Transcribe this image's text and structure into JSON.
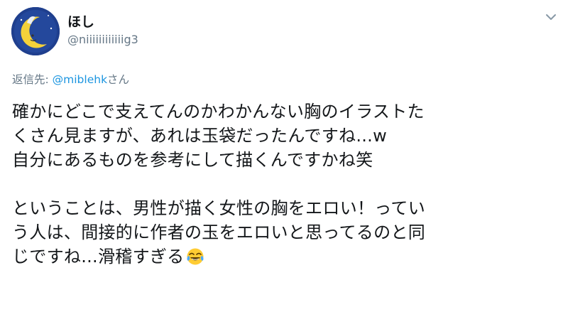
{
  "tweet": {
    "display_name": "ほし",
    "handle": "@niiiiiiiiiiiig3",
    "reply": {
      "prefix": "返信先: ",
      "mention": "@miblehk",
      "suffix": "さん"
    },
    "body_lines": [
      "確かにどこで支えてんのかわかんない胸のイラストた",
      "くさん見ますが、あれは玉袋だったんですね...w",
      "自分にあるものを参考にして描くんですかね笑",
      "",
      "ということは、男性が描く女性の胸をエロい！ってい",
      "う人は、間接的に作者の玉をエロいと思ってるのと同",
      "じですね...滑稽すぎる"
    ],
    "trailing_emoji": "face-with-tears-of-joy",
    "colors": {
      "avatar_bg": "#1f3f8e",
      "link": "#1b95e0",
      "secondary_text": "#657786"
    }
  }
}
